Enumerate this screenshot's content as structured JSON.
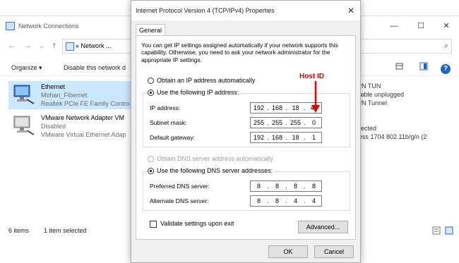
{
  "bg_window": {
    "title": "Network Connections",
    "controls": {
      "minimize": "—",
      "maximize": "☐",
      "close": "✕"
    },
    "nav": {
      "back": "←",
      "forward": "→",
      "up": "↑",
      "address_chevrons": "«",
      "address_text": "Network ..."
    },
    "search": {
      "icon_glyph": "⌕"
    },
    "cmdbar": {
      "organize": "Organize ▾",
      "disable": "Disable this network d"
    },
    "help_glyph": "?",
    "adapters": [
      {
        "name": "Ethernet",
        "line2": "Mohan_Fibernet",
        "line3": "Realtek PCIe FE Family Contro"
      },
      {
        "name": "VMware Network Adapter VM",
        "line2": "Disabled",
        "line3": "VMware Virtual Ethernet Adap"
      }
    ],
    "right_text": [
      "PN TUN",
      "cable unplugged",
      "PN Tunnel",
      "nected",
      "less 1704 802.11b/g/n (2"
    ],
    "status": {
      "items": "6 items",
      "selected": "1 item selected"
    }
  },
  "dialog": {
    "title": "Internet Protocol Version 4 (TCP/IPv4) Properties",
    "close_glyph": "✕",
    "tab": "General",
    "description": "You can get IP settings assigned automatically if your network supports this capability. Otherwise, you need to ask your network administrator for the appropriate IP settings.",
    "opt_auto_ip": "Obtain an IP address automatically",
    "opt_manual_ip": "Use the following IP address:",
    "ip_fields": [
      {
        "label": "IP address:",
        "octets": [
          "192",
          "168",
          "18",
          "45"
        ]
      },
      {
        "label": "Subnet mask:",
        "octets": [
          "255",
          "255",
          "255",
          "0"
        ]
      },
      {
        "label": "Default gateway:",
        "octets": [
          "192",
          "168",
          "18",
          "1"
        ]
      }
    ],
    "opt_auto_dns": "Obtain DNS server address automatically",
    "opt_manual_dns": "Use the following DNS server addresses:",
    "dns_fields": [
      {
        "label": "Preferred DNS server:",
        "octets": [
          "8",
          "8",
          "8",
          "8"
        ]
      },
      {
        "label": "Alternate DNS server:",
        "octets": [
          "8",
          "8",
          "4",
          "4"
        ]
      }
    ],
    "validate_label": "Validate settings upon exit",
    "validate_checked": false,
    "advanced_button": "Advanced...",
    "ok_button": "OK",
    "cancel_button": "Cancel"
  },
  "annotation": {
    "host_id_label": "Host ID",
    "color": "#e00000"
  },
  "colors": {
    "selection": "#cce8ff",
    "help": "#1e64c8"
  }
}
